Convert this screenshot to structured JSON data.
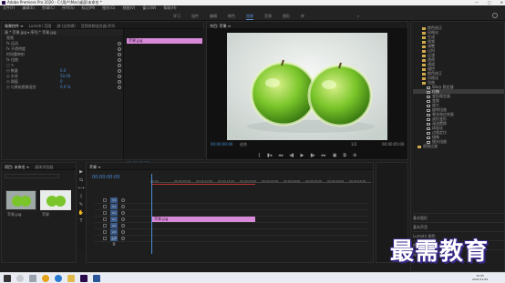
{
  "titlebar": {
    "title": "Adobe Premiere Pro 2020 - C:\\用户\\Mac\\桌面\\未命名 *"
  },
  "menubar": {
    "items": [
      "文件(F)",
      "编辑(E)",
      "剪辑(C)",
      "序列(S)",
      "标记(M)",
      "图形(G)",
      "视图(V)",
      "窗口(W)",
      "帮助(H)"
    ]
  },
  "workspaces": {
    "tabs": [
      "学习",
      "组件",
      "编辑",
      "颜色",
      "效果",
      "音频",
      "图形",
      "库"
    ],
    "active_index": 4,
    "more": "»"
  },
  "effect_controls": {
    "tabs": [
      "效果控件 ≡",
      "Lumetri 范围",
      "源:(无剪辑)",
      "音频剪辑混合器:序列"
    ],
    "active_index": 0,
    "header": "源 * 苹果.jpg ▾   序列 * 苹果.jpg",
    "section": "视频",
    "rows": [
      {
        "label": "fx 运动",
        "value": ""
      },
      {
        "label": "fx 不透明度",
        "value": ""
      },
      {
        "label": "  时间重映射",
        "value": ""
      },
      {
        "label": "fx 扭曲",
        "value": ""
      },
      {
        "label": "  ▢ ✎",
        "value": ""
      },
      {
        "label": "  ◷ 数量",
        "value": "0.0"
      },
      {
        "label": "  ◷ 半径",
        "value": "50.00"
      },
      {
        "label": "  ◷ 阈值",
        "value": "0"
      },
      {
        "label": "  ◷ 与原始图像混合",
        "value": "0.0 %"
      }
    ],
    "clip_label": "苹果.jpg",
    "timecode": "00:00:00:00"
  },
  "program": {
    "tab": "节目: 苹果 ≡",
    "timecode": "00:00:00:00",
    "fit": "适合",
    "scale": "1/2",
    "duration": "00:00:05:00",
    "controls": [
      "{",
      "▮◂",
      "◂◂",
      "◂▮",
      "▶",
      "▮▸",
      "▸▸",
      "▣",
      "⧉",
      "⊕"
    ]
  },
  "right_panel": {
    "items": [
      {
        "label": "颜色校正",
        "type": "folder",
        "indent": 2
      },
      {
        "label": "风格化",
        "type": "folder",
        "indent": 2
      },
      {
        "label": "生成",
        "type": "folder",
        "indent": 2
      },
      {
        "label": "视频",
        "type": "folder",
        "indent": 2
      },
      {
        "label": "调整",
        "type": "folder",
        "indent": 2
      },
      {
        "label": "过时",
        "type": "folder",
        "indent": 2
      },
      {
        "label": "过渡",
        "type": "folder",
        "indent": 2
      },
      {
        "label": "透视",
        "type": "folder",
        "indent": 2
      },
      {
        "label": "通道",
        "type": "folder",
        "indent": 2
      },
      {
        "label": "键控",
        "type": "folder",
        "indent": 2
      },
      {
        "label": "颜色校正",
        "type": "folder",
        "indent": 2
      },
      {
        "label": "风格化",
        "type": "folder",
        "indent": 2
      },
      {
        "label": "扭曲",
        "type": "folder",
        "indent": 2
      },
      {
        "label": "Warp 稳定器",
        "type": "fx",
        "indent": 3
      },
      {
        "label": "位移",
        "type": "fx",
        "indent": 3
      },
      {
        "label": "变形稳定器",
        "type": "fx",
        "indent": 3
      },
      {
        "label": "变换",
        "type": "fx",
        "indent": 3
      },
      {
        "label": "放大",
        "type": "fx",
        "indent": 3
      },
      {
        "label": "旋转扭曲",
        "type": "fx",
        "indent": 3
      },
      {
        "label": "果冻效应修复",
        "type": "fx",
        "indent": 3
      },
      {
        "label": "波形变形",
        "type": "fx",
        "indent": 3
      },
      {
        "label": "湍流置换",
        "type": "fx",
        "indent": 3
      },
      {
        "label": "球面化",
        "type": "fx",
        "indent": 3
      },
      {
        "label": "边角定位",
        "type": "fx",
        "indent": 3
      },
      {
        "label": "镜像",
        "type": "fx",
        "indent": 3
      },
      {
        "label": "镜头扭曲",
        "type": "fx",
        "indent": 3
      },
      {
        "label": "视频过渡",
        "type": "folder",
        "indent": 1
      }
    ],
    "selected_index": 14,
    "footer": [
      "基本图形",
      "基本声音",
      "Lumetri 颜色",
      "库",
      "标记"
    ]
  },
  "project": {
    "tabs": [
      "项目: 未命名 ≡",
      "媒体浏览器"
    ],
    "search_placeholder": "",
    "items": [
      {
        "label": "苹果.jpg"
      },
      {
        "label": "苹果"
      }
    ]
  },
  "timeline": {
    "tab": "苹果 ≡",
    "timecode": "00:00:00:00",
    "ruler": [
      "00:00",
      "00:00:05:00",
      "00:00:10:00",
      "00:00:15:00",
      "00:00:20:00",
      "00:00:25:00",
      "00:00:30:00",
      "00:00:35:00",
      "00:00:40:00",
      "00:00:45:00"
    ],
    "tracks": [
      "V3",
      "V2",
      "V1",
      "A1",
      "A2",
      "A3",
      "主声道"
    ],
    "clip_label": "苹果.jpg"
  },
  "tools": [
    "▶",
    "⇆",
    "⟷",
    "◊",
    "✎",
    "✋",
    "T"
  ],
  "taskbar": {
    "icons": [
      "start",
      "search",
      "task-view",
      "chrome",
      "edge",
      "explorer",
      "premiere",
      "word"
    ],
    "clock_time": "15:05",
    "clock_date": "2021/11/22"
  },
  "watermark": "最需教育",
  "colors": {
    "accent": "#4a8ed6",
    "clip": "#d88ad8",
    "apple": "#7ac52a"
  }
}
